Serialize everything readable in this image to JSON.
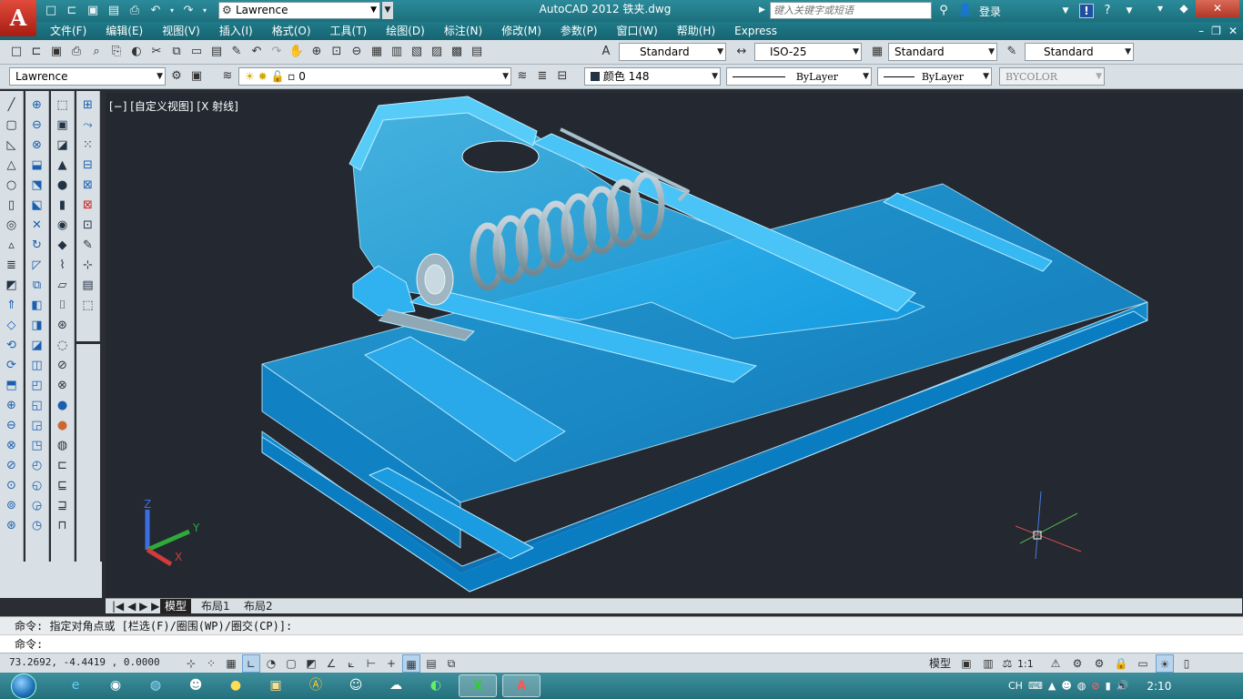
{
  "title_bar": {
    "app_logo": "A",
    "workspace": "Lawrence",
    "title": "AutoCAD 2012    铁夹.dwg",
    "search_placeholder": "键入关键字或短语",
    "login": "登录",
    "quick_access_icons": [
      "new-icon",
      "open-icon",
      "save-icon",
      "save-as-icon",
      "plot-icon",
      "undo-icon",
      "redo-icon"
    ],
    "window_controls": [
      "minimize",
      "restore",
      "close"
    ]
  },
  "menu_bar": {
    "items": [
      "文件(F)",
      "编辑(E)",
      "视图(V)",
      "插入(I)",
      "格式(O)",
      "工具(T)",
      "绘图(D)",
      "标注(N)",
      "修改(M)",
      "参数(P)",
      "窗口(W)",
      "帮助(H)",
      "Express"
    ]
  },
  "toolbar1": {
    "text_style": "Standard",
    "dim_style": "ISO-25",
    "table_style": "Standard",
    "multileader_style": "Standard"
  },
  "toolbar2": {
    "workspace": "Lawrence",
    "layer": "0",
    "color": "颜色 148",
    "linetype": "ByLayer",
    "lineweight": "ByLayer",
    "plot_style": "BYCOLOR"
  },
  "viewport": {
    "label": "[−] [自定义视图] [X 射线]",
    "axis_labels": {
      "z": "Z",
      "y": "Y",
      "x": "X"
    },
    "accent_color": "#1aa3e6"
  },
  "layout_tabs": [
    "模型",
    "布局1",
    "布局2"
  ],
  "command": {
    "history": "命令: 指定对角点或 [栏选(F)/圈围(WP)/圈交(CP)]:",
    "prompt": "命令:"
  },
  "status_bar": {
    "coordinates": "73.2692, -4.4419 , 0.0000",
    "model_label": "模型",
    "annotation_scale": "1:1"
  },
  "taskbar": {
    "input_method": "CH",
    "clock": "2:10"
  }
}
